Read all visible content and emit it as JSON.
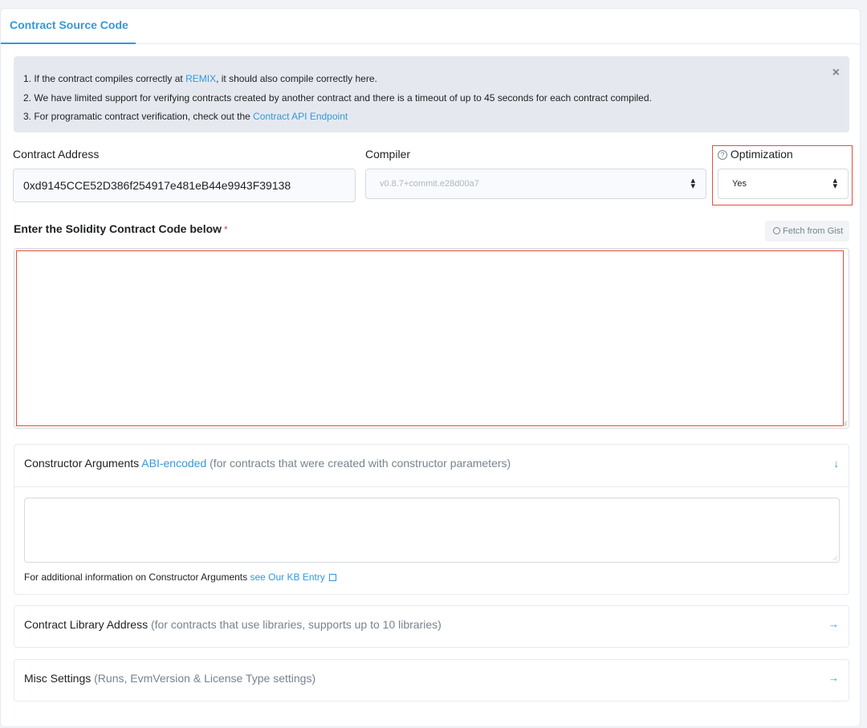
{
  "tabs": {
    "active": "Contract Source Code"
  },
  "alert": {
    "line1_prefix": "1. If the contract compiles correctly at ",
    "line1_link": "REMIX",
    "line1_suffix": ", it should also compile correctly here.",
    "line2": "2. We have limited support for verifying contracts created by another contract and there is a timeout of up to 45 seconds for each contract compiled.",
    "line3_prefix": "3. For programatic contract verification, check out the ",
    "line3_link": "Contract API Endpoint",
    "close_icon": "×"
  },
  "fields": {
    "contract_address_label": "Contract Address",
    "contract_address_value": "0xd9145CCE52D386f254917e481eB44e9943F39138",
    "compiler_label": "Compiler",
    "compiler_value": "v0.8.7+commit.e28d00a7",
    "optimization_label": "Optimization",
    "optimization_value": "Yes",
    "help_icon": "?"
  },
  "source": {
    "title": "Enter the Solidity Contract Code below",
    "required_mark": "*",
    "fetch_button": "Fetch from Gist",
    "code_value": ""
  },
  "constructor": {
    "title": "Constructor Arguments",
    "link": "ABI-encoded",
    "desc": "(for contracts that were created with constructor parameters)",
    "note_prefix": "For additional information on Constructor Arguments ",
    "note_link": "see Our KB Entry",
    "arrow": "↓"
  },
  "library": {
    "title": "Contract Library Address",
    "desc": "(for contracts that use libraries, supports up to 10 libraries)",
    "arrow": "→"
  },
  "misc": {
    "title": "Misc Settings",
    "desc": "(Runs, EvmVersion & License Type settings)",
    "arrow": "→"
  },
  "colors": {
    "accent": "#3498db",
    "highlight": "#e74c3c",
    "alert_bg": "#e5e9ef"
  }
}
